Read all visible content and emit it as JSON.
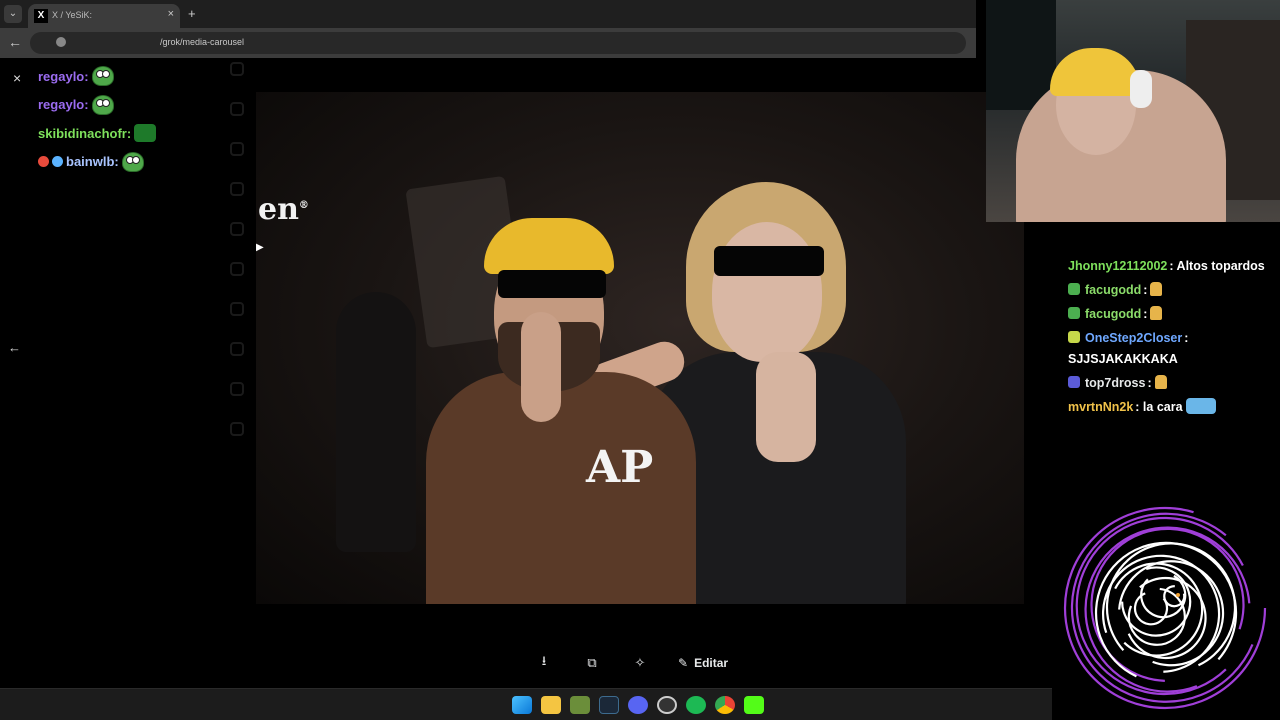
{
  "browser": {
    "tab_title": "X / YeSiK:",
    "tab_close": "×",
    "tab_new": "+",
    "tab_menu": "⌄",
    "favicon": "X",
    "back_arrow": "←",
    "url_visible": "/grok/media-carousel"
  },
  "overlay_chat": {
    "close": "×",
    "back": "←",
    "messages": [
      {
        "user": "regaylo:",
        "color": "#9b6cf0",
        "emote": "pepe"
      },
      {
        "user": "regaylo:",
        "color": "#9b6cf0",
        "emote": "pepe"
      },
      {
        "user": "skibidinachofr:",
        "color": "#7ee05c",
        "emote": "block"
      },
      {
        "user": "bainwlb:",
        "color": "#a9c4ff",
        "emote": "pepe",
        "badges": [
          "#e84b3c",
          "#5bb3ff"
        ]
      }
    ]
  },
  "photo": {
    "poster_text": "en",
    "poster_suffix": "®",
    "poster_arrow": "▶",
    "hoodie_logo": "AP"
  },
  "media_toolbar": {
    "download_icon": "⭳",
    "copy_icon": "⧉",
    "grok_icon": "✧",
    "edit_icon": "✎",
    "edit_label": "Editar"
  },
  "side_chat": {
    "messages": [
      {
        "user": "Jhonny12112002",
        "color": "#7ee05c",
        "text": ": Altos topardos",
        "badge": null,
        "emote": null
      },
      {
        "user": "facugodd",
        "color": "#8bdc6a",
        "text": ":",
        "badge": "#4caf50",
        "emote": "hand"
      },
      {
        "user": "facugodd",
        "color": "#8bdc6a",
        "text": ":",
        "badge": "#4caf50",
        "emote": "hand"
      },
      {
        "user": "OneStep2Closer",
        "color": "#6fa8ff",
        "text": ": SJJSJAKAKKAKA",
        "badge": "#c6d84a",
        "emote": null
      },
      {
        "user": "top7dross",
        "color": "#e7e9ea",
        "text": ":",
        "badge": "#5b5bd8",
        "emote": "hand"
      },
      {
        "user": "mvrtnNn2k",
        "color": "#f0c24a",
        "text": ": la cara",
        "badge": null,
        "emote": "wide"
      }
    ]
  },
  "colors": {
    "chrome_bg": "#1f1f1f",
    "address_bg": "#3c3c3c",
    "spiral_purple": "#a03fd8"
  }
}
